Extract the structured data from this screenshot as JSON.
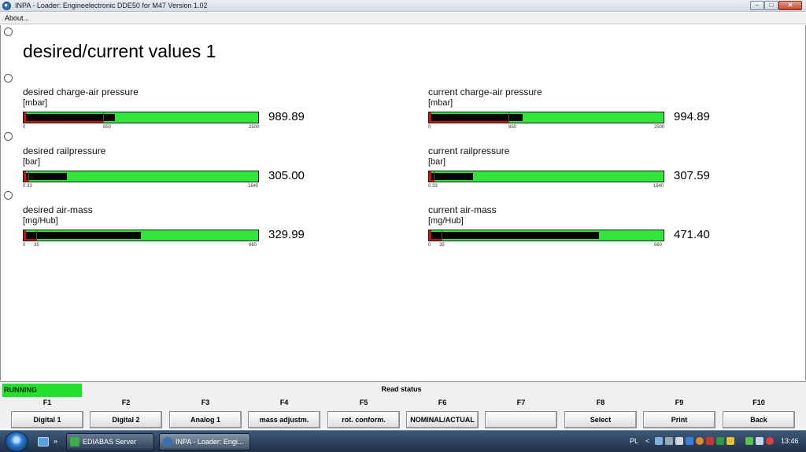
{
  "window": {
    "title": "INPA - Loader:  Engineelectronic DDE50 for M47 Version 1.02",
    "minimize_glyph": "–",
    "maximize_glyph": "□",
    "close_glyph": "✕"
  },
  "menu": {
    "about": "About..."
  },
  "page": {
    "title": "desired/current values 1",
    "gauges": [
      {
        "label": "desired charge-air pressure",
        "unit": "[mbar]",
        "value": "989.89",
        "fill_fraction": 0.39,
        "red_fraction": 0.34,
        "mark_fraction": 0.34,
        "ticks": [
          "0",
          "850",
          "2500"
        ]
      },
      {
        "label": "current charge-air pressure",
        "unit": "[mbar]",
        "value": "994.89",
        "fill_fraction": 0.4,
        "red_fraction": 0.34,
        "mark_fraction": 0.34,
        "ticks": [
          "0",
          "850",
          "2500"
        ]
      },
      {
        "label": "desired railpressure",
        "unit": "[bar]",
        "value": "305.00",
        "fill_fraction": 0.186,
        "red_fraction": 0.02,
        "mark_fraction": 0.02,
        "ticks": [
          "0 33",
          "1640"
        ]
      },
      {
        "label": "current railpressure",
        "unit": "[bar]",
        "value": "307.59",
        "fill_fraction": 0.188,
        "red_fraction": 0.02,
        "mark_fraction": 0.02,
        "ticks": [
          "0 33",
          "1640"
        ]
      },
      {
        "label": "desired air-mass",
        "unit": "[mg/Hub]",
        "value": "329.99",
        "fill_fraction": 0.5,
        "red_fraction": 0.053,
        "mark_fraction": 0.053,
        "ticks": [
          "0",
          "35",
          "660"
        ]
      },
      {
        "label": "current air-mass",
        "unit": "[mg/Hub]",
        "value": "471.40",
        "fill_fraction": 0.725,
        "red_fraction": 0.053,
        "mark_fraction": 0.053,
        "ticks": [
          "0",
          "35",
          "660"
        ]
      }
    ]
  },
  "status": {
    "running": "RUNNING",
    "read_status": "Read status",
    "keys": [
      {
        "key": "F1",
        "label": "Digital 1"
      },
      {
        "key": "F2",
        "label": "Digital 2"
      },
      {
        "key": "F3",
        "label": "Analog 1"
      },
      {
        "key": "F4",
        "label": "mass adjustm."
      },
      {
        "key": "F5",
        "label": "rot. conform."
      },
      {
        "key": "F6",
        "label": "NOMINAL/ACTUAL"
      },
      {
        "key": "F7",
        "label": ""
      },
      {
        "key": "F8",
        "label": "Select"
      },
      {
        "key": "F9",
        "label": "Print"
      },
      {
        "key": "F10",
        "label": "Back"
      }
    ]
  },
  "taskbar": {
    "quick_launch_arrow": "»",
    "items": [
      {
        "label": "EDIABAS Server",
        "active": false
      },
      {
        "label": "INPA - Loader:  Engi...",
        "active": true
      }
    ],
    "lang": "PL",
    "chevron": "<",
    "clock": "13:46"
  },
  "colors": {
    "gauge_green": "#33e63d",
    "gauge_fill": "#050505",
    "gauge_limit": "#cc1111",
    "running_green": "#22e12c"
  }
}
